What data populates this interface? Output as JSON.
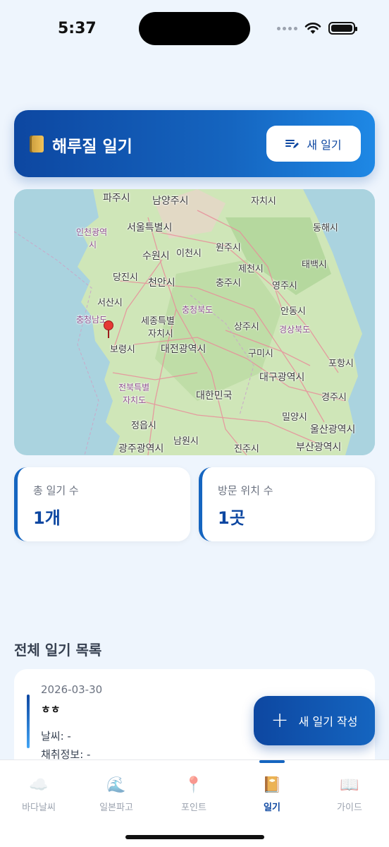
{
  "status": {
    "time": "5:37"
  },
  "header": {
    "title": "해루질 일기",
    "new_button": "새 일기",
    "icon": "book-icon"
  },
  "map": {
    "labels": [
      "파주시",
      "남양주시",
      "자치시",
      "인천광역",
      "시",
      "서울특별시",
      "동해시",
      "수원시",
      "이천시",
      "원주시",
      "당진시",
      "천안시",
      "제천시",
      "태백시",
      "충주시",
      "영주시",
      "서산시",
      "충청북도",
      "안동시",
      "충청남도",
      "세종특별",
      "자치시",
      "상주시",
      "경상북도",
      "보령시",
      "대전광역시",
      "구미시",
      "포항시",
      "대구광역시",
      "전북특별",
      "대한민국",
      "자치도",
      "경주시",
      "밀양시",
      "정읍시",
      "남원시",
      "울산광역시",
      "광주광역시",
      "진주시",
      "부산광역시"
    ]
  },
  "stats": [
    {
      "label": "총 일기 수",
      "value": "1개"
    },
    {
      "label": "방문 위치 수",
      "value": "1곳"
    }
  ],
  "list": {
    "title": "전체 일기 목록",
    "entry": {
      "date": "2026-03-30",
      "title": "ㅎㅎ",
      "weather": "날씨: -",
      "catch": "채취정보: -"
    }
  },
  "fab": {
    "label": "새 일기 작성"
  },
  "nav": [
    {
      "label": "바다날씨",
      "icon": "☁️"
    },
    {
      "label": "일본파고",
      "icon": "🌊"
    },
    {
      "label": "포인트",
      "icon": "📍"
    },
    {
      "label": "일기",
      "icon": "📔"
    },
    {
      "label": "가이드",
      "icon": "📖"
    }
  ],
  "colors": {
    "primary": "#0d47a1",
    "accent": "#1565c0",
    "background": "#eef5fd"
  }
}
